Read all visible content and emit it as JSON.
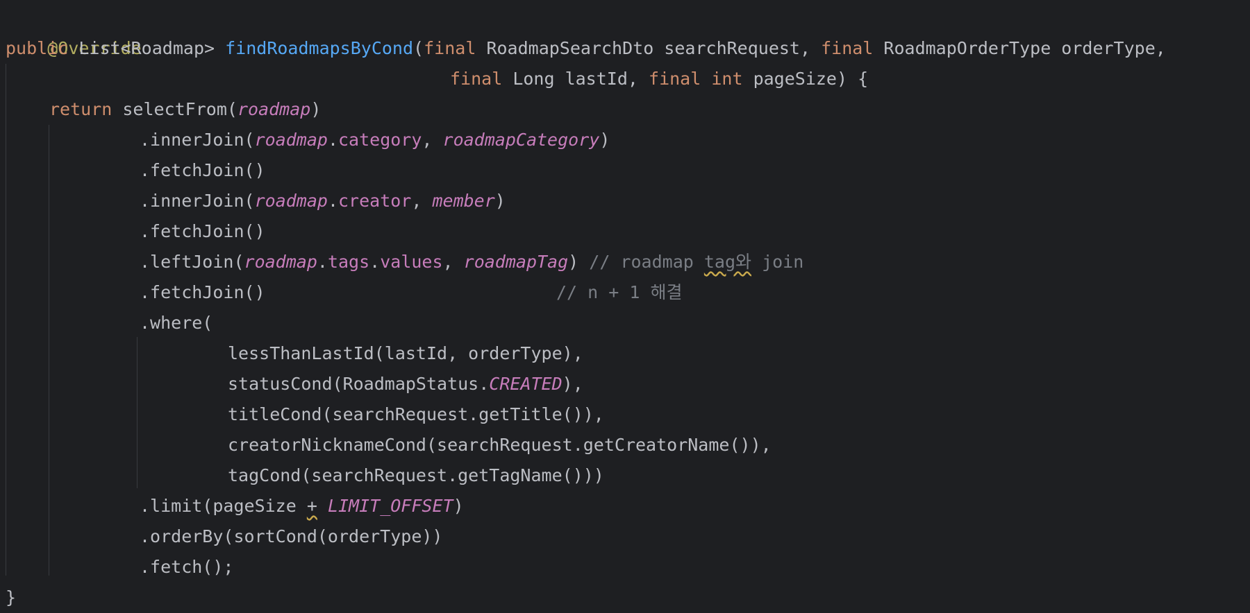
{
  "code": {
    "annotation": "@Override",
    "sig": {
      "kw_public": "public",
      "ret_type": "List<Roadmap>",
      "method_name": "findRoadmapsByCond",
      "open_paren": "(",
      "kw_final1": "final",
      "param1": "RoadmapSearchDto searchRequest,",
      "kw_final2": "final",
      "param2": "RoadmapOrderType orderType,",
      "kw_final3": "final",
      "param3": "Long lastId,",
      "kw_final4": "final",
      "kw_int": "int",
      "param4": "pageSize) {"
    },
    "ret": {
      "kw_return": "return",
      "call": "selectFrom(",
      "field": "roadmap",
      "close": ")"
    },
    "inner_join1": {
      "call": ".innerJoin(",
      "field": "roadmap",
      "dot": ".",
      "prop": "category",
      "sep": ", ",
      "field2": "roadmapCategory",
      "close": ")"
    },
    "fetch_join1": ".fetchJoin()",
    "inner_join2": {
      "call": ".innerJoin(",
      "field": "roadmap",
      "dot": ".",
      "prop": "creator",
      "sep": ", ",
      "field2": "member",
      "close": ")"
    },
    "fetch_join2": ".fetchJoin()",
    "left_join": {
      "call": ".leftJoin(",
      "field": "roadmap",
      "dot1": ".",
      "prop1": "tags",
      "dot2": ".",
      "prop2": "values",
      "sep": ", ",
      "field2": "roadmapTag",
      "close": ")",
      "comment_pre": "// roadmap ",
      "comment_warn": "tag와",
      "comment_post": " join"
    },
    "fetch_join3": {
      "call": ".fetchJoin()",
      "comment": "// n + 1 해결"
    },
    "where": ".where(",
    "cond1": "lessThanLastId(lastId, orderType),",
    "cond2": {
      "pre": "statusCond(RoadmapStatus.",
      "field": "CREATED",
      "post": "),"
    },
    "cond3": "titleCond(searchRequest.getTitle()),",
    "cond4": "creatorNicknameCond(searchRequest.getCreatorName()),",
    "cond5": "tagCond(searchRequest.getTagName()))",
    "limit": {
      "pre": ".limit(pageSize ",
      "op": "+",
      "sp": " ",
      "field": "LIMIT_OFFSET",
      "close": ")"
    },
    "order_by": ".orderBy(sortCond(orderType))",
    "fetch": ".fetch();",
    "close_brace": "}"
  }
}
